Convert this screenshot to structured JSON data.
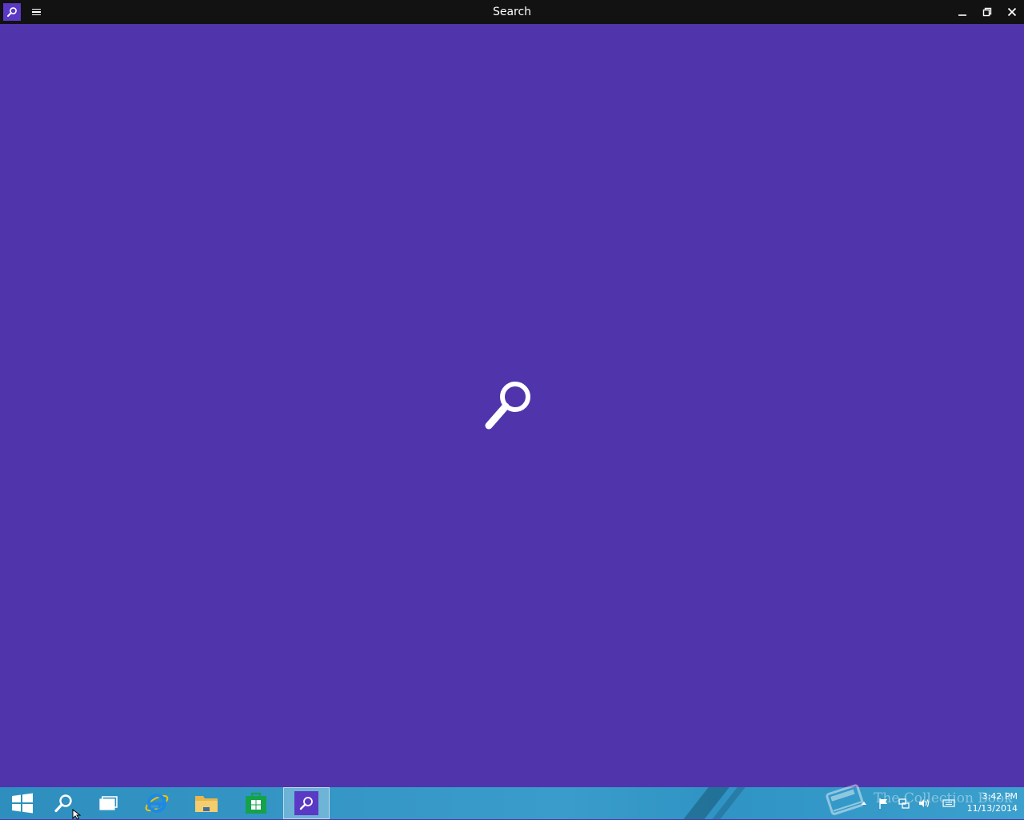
{
  "window": {
    "title": "Search",
    "app_icon": "search-icon",
    "menu_icon": "hamburger-icon",
    "controls": [
      "minimize-icon",
      "maximize-icon",
      "close-icon"
    ]
  },
  "content": {
    "background": "#5034ac",
    "splash_icon": "search-icon"
  },
  "taskbar": {
    "items": [
      {
        "name": "start",
        "icon": "windows-logo-icon"
      },
      {
        "name": "search",
        "icon": "search-icon"
      },
      {
        "name": "task-view",
        "icon": "task-view-icon"
      },
      {
        "name": "internet-explorer",
        "icon": "ie-icon"
      },
      {
        "name": "file-explorer",
        "icon": "folder-icon"
      },
      {
        "name": "store",
        "icon": "store-icon"
      },
      {
        "name": "search-app",
        "icon": "search-icon",
        "active": true
      }
    ],
    "tray": {
      "icons": [
        "chevron-up-icon",
        "flag-icon",
        "network-icon",
        "volume-icon",
        "keyboard-icon"
      ],
      "time": "3:42 PM",
      "date": "11/13/2014"
    }
  },
  "watermark": {
    "text": "The Collection Book"
  },
  "colors": {
    "accent": "#5034ac",
    "titlebar": "#121212",
    "taskbar": "#3a9cca"
  }
}
